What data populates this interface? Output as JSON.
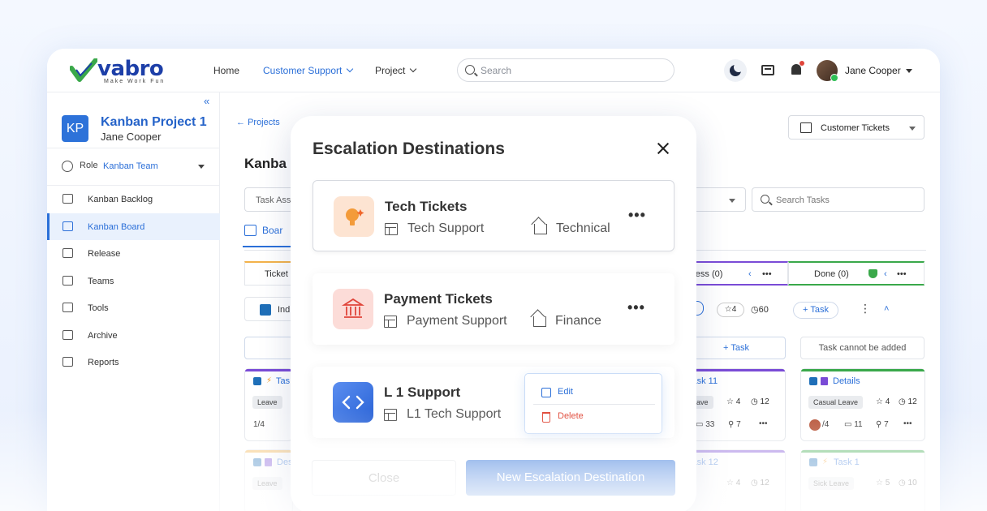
{
  "brand": {
    "name": "vabro",
    "tagline": "Make Work Fun",
    "colors": {
      "primary": "#2b6fd8",
      "danger": "#e04a3a",
      "accent_green": "#2fbf55"
    }
  },
  "topbar": {
    "nav": [
      {
        "label": "Home"
      },
      {
        "label": "Customer Support"
      },
      {
        "label": "Project"
      }
    ],
    "search_placeholder": "Search",
    "user_name": "Jane Cooper"
  },
  "sidebar": {
    "project_initials": "KP",
    "project_title": "Kanban Project 1",
    "project_owner": "Jane Cooper",
    "role_label": "Role",
    "role_value": "Kanban Team",
    "items": [
      {
        "label": "Kanban Backlog",
        "icon": "backlog-icon"
      },
      {
        "label": "Kanban Board",
        "icon": "board-icon"
      },
      {
        "label": "Release",
        "icon": "send-icon"
      },
      {
        "label": "Teams",
        "icon": "teams-icon"
      },
      {
        "label": "Tools",
        "icon": "tools-icon"
      },
      {
        "label": "Archive",
        "icon": "archive-icon"
      },
      {
        "label": "Reports",
        "icon": "reports-icon"
      }
    ]
  },
  "main": {
    "back_label": "Projects",
    "page_title": "Kanba",
    "view_select": "Customer Tickets",
    "task_filter": "Task Ass",
    "search_tasks_placeholder": "Search Tasks",
    "board_tab": "Boar",
    "columns": [
      {
        "label": "Ticket"
      },
      {
        "label": "gress (0)"
      },
      {
        "label": "Done (0)"
      }
    ],
    "group_label": "Ind",
    "row_stats": {
      "stars": "4",
      "time": "60",
      "add_task": "+ Task"
    },
    "add_task_label": "+ Task",
    "cannot_add": "Task cannot be added",
    "cards": [
      {
        "title": "Tas",
        "chip": "Leave",
        "meta": "1/4"
      },
      {
        "title": "Task 11",
        "chip": "eave",
        "stars": "4",
        "time": "12",
        "comments": "33",
        "attach": "7"
      },
      {
        "title": "Details",
        "chip": "Casual Leave",
        "stars": "4",
        "time": "12",
        "meta": "/4",
        "comments": "11",
        "attach": "7"
      },
      {
        "title": "Des",
        "chip": "Leave"
      },
      {
        "title": "Task 12",
        "stars": "4",
        "time": "12"
      },
      {
        "title": "Task 1",
        "chip": "Sick Leave",
        "stars": "5",
        "time": "10"
      }
    ]
  },
  "modal": {
    "title": "Escalation Destinations",
    "destinations": [
      {
        "name": "Tech Tickets",
        "team": "Tech Support",
        "category": "Technical",
        "icon": "lightbulb-icon"
      },
      {
        "name": "Payment Tickets",
        "team": "Payment Support",
        "category": "Finance",
        "icon": "bank-icon"
      },
      {
        "name": "L 1 Support",
        "team": "L1 Tech Support",
        "category": "",
        "icon": "code-icon"
      }
    ],
    "menu": {
      "edit": "Edit",
      "delete": "Delete"
    },
    "close_label": "Close",
    "new_label": "New Escalation Destination"
  }
}
